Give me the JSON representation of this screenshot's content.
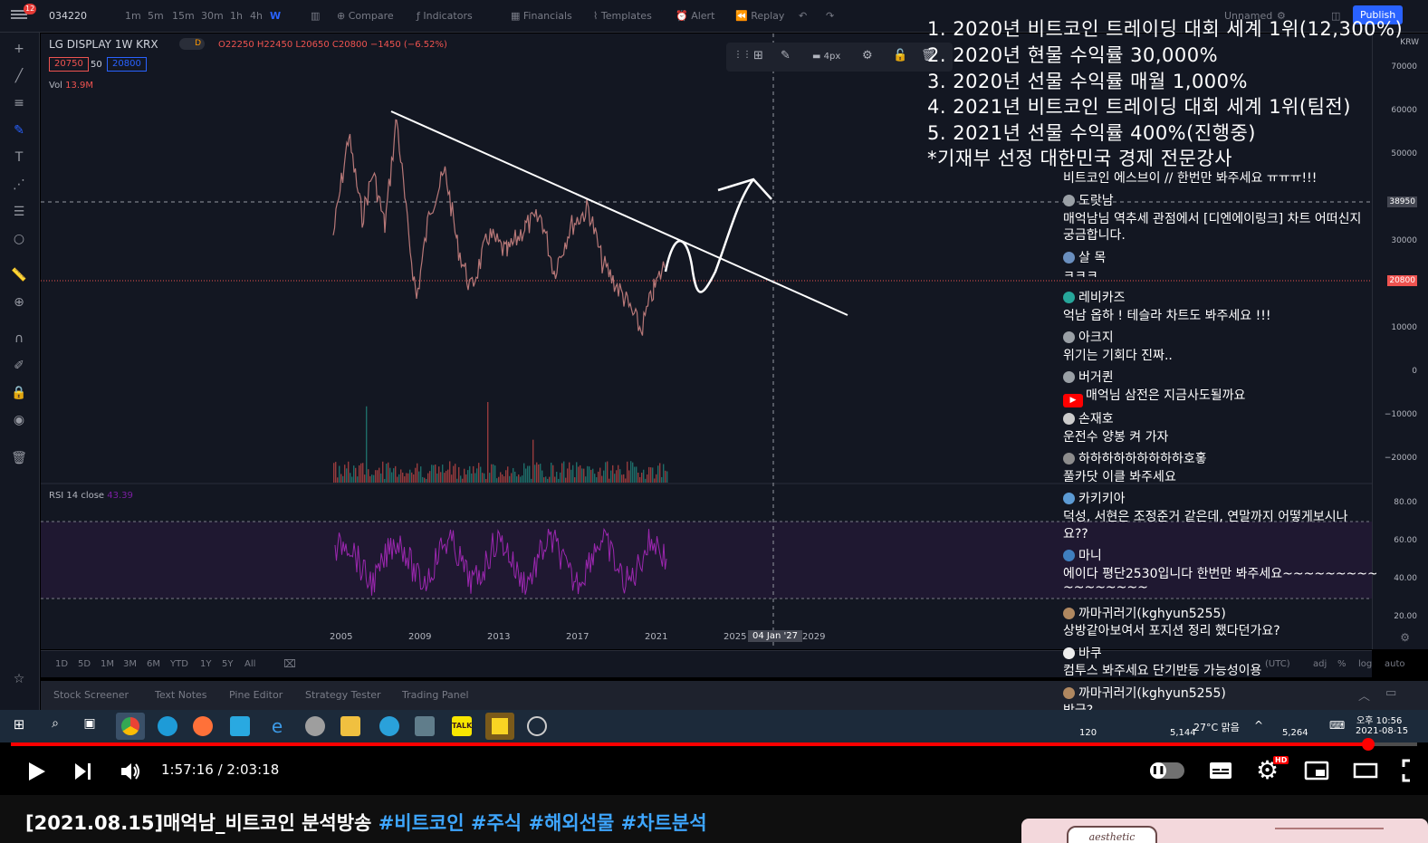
{
  "tradingview": {
    "notif_count": "12",
    "symbol_code": "034220",
    "intervals": [
      "1m",
      "5m",
      "15m",
      "30m",
      "1h",
      "4h",
      "W"
    ],
    "top_menu": [
      "Compare",
      "Indicators",
      "Financials",
      "Templates",
      "Alert",
      "Replay"
    ],
    "top_right": [
      "Unnamed",
      "Publish"
    ],
    "symbol_line": "LG DISPLAY  1W  KRX",
    "ohlc": "O22250 H22450 L20650 C20800 −1450 (−6.52%)",
    "bid": "20750",
    "spread": "50",
    "ask": "20800",
    "volume_label": "Vol",
    "volume_value": "13.9M",
    "rsi_label": "RSI 14 close",
    "rsi_value": "43.39",
    "stroke_width": "4px",
    "currency": "KRW",
    "price_axis": [
      "70000",
      "60000",
      "50000",
      "38950",
      "30000",
      "20800",
      "10000",
      "0",
      "−10000",
      "−20000",
      "80.00",
      "60.00",
      "40.00",
      "20.00"
    ],
    "x_axis": [
      "2005",
      "2009",
      "2013",
      "2017",
      "2021",
      "2025",
      "04 Jan '27",
      "2029"
    ],
    "ranges": [
      "1D",
      "5D",
      "1M",
      "3M",
      "6M",
      "YTD",
      "1Y",
      "5Y",
      "All"
    ],
    "bottom_right": [
      "(UTC)",
      "adj",
      "%",
      "log",
      "auto"
    ],
    "panels": [
      "Stock Screener",
      "Text Notes",
      "Pine Editor",
      "Strategy Tester",
      "Trading Panel"
    ]
  },
  "overlay_lines": [
    "1. 2020년 비트코인 트레이딩 대회 세계 1위(12,300%)",
    "2. 2020년 현물 수익률 30,000%",
    "3. 2020년 선물 수익률 매월 1,000%",
    "4. 2021년 비트코인 트레이딩 대회 세계 1위(팀전)",
    "5. 2021년 선물 수익률 400%(진행중)",
    "*기재부 선정 대한민국 경제 전문강사"
  ],
  "chat": [
    {
      "user": "",
      "msg": "비트코인 에스브이 // 한번만 봐주세요 ㅠㅠㅠ!!!"
    },
    {
      "user": "도랏남",
      "msg": "매억남님 역추세 관점에서 [디엔에이링크] 차트 어떠신지"
    },
    {
      "user": "",
      "msg": "궁금합니다."
    },
    {
      "user": "살 목",
      "msg": "ㅋㅋㅋ"
    },
    {
      "user": "레비카즈",
      "msg": "억남 옵하 ! 테슬라 차트도 봐주세요 !!!"
    },
    {
      "user": "아크지",
      "msg": "위기는 기회다 진짜.."
    },
    {
      "user": "버거퀸",
      "msg": "매억님 삼전은 지금사도될까요"
    },
    {
      "user": "손재호",
      "msg": "운전수 양봉 켜 가자"
    },
    {
      "user": "하하하하하하하하하호홓",
      "msg": "풀카닷 이클 봐주세요"
    },
    {
      "user": "카키키아",
      "msg": "덕성, 서현은 조정준거 같은데, 연말까지 어떻게보시나"
    },
    {
      "user": "",
      "msg": "요??"
    },
    {
      "user": "마니",
      "msg": "에이다 평단2530입니다 한번만 봐주세요~~~~~~~~~~~~"
    },
    {
      "user": "",
      "msg": "~~~~~~~~"
    },
    {
      "user": "까마귀러기(kghyun5255)",
      "msg": "상방같아보여서 포지션 정리 했다던가요?"
    },
    {
      "user": "바쿠",
      "msg": "컴투스 봐주세요 단기반등 가능성이용"
    },
    {
      "user": "까마귀러기(kghyun5255)",
      "msg": "방금?"
    }
  ],
  "taskbar": {
    "badge_left": "120",
    "badge_mid": "5,144",
    "weather": "27°C 맑음",
    "badge_right": "5,264",
    "time": "오후 10:56",
    "date": "2021-08-15"
  },
  "player": {
    "time": "1:57:16 / 2:03:18",
    "hd": "HD",
    "progress": 0.9652
  },
  "video_title": {
    "main": "[2021.08.15]매억남_비트코인 분석방송 ",
    "tags": [
      "#비트코인",
      "#주식",
      "#해외선물",
      "#차트분석"
    ]
  },
  "thumb_text": "aesthetic",
  "colors": {
    "accent": "#ff0000",
    "link": "#3ea6ff",
    "tv_bg": "#131722",
    "rsi": "#7b1fa2"
  }
}
